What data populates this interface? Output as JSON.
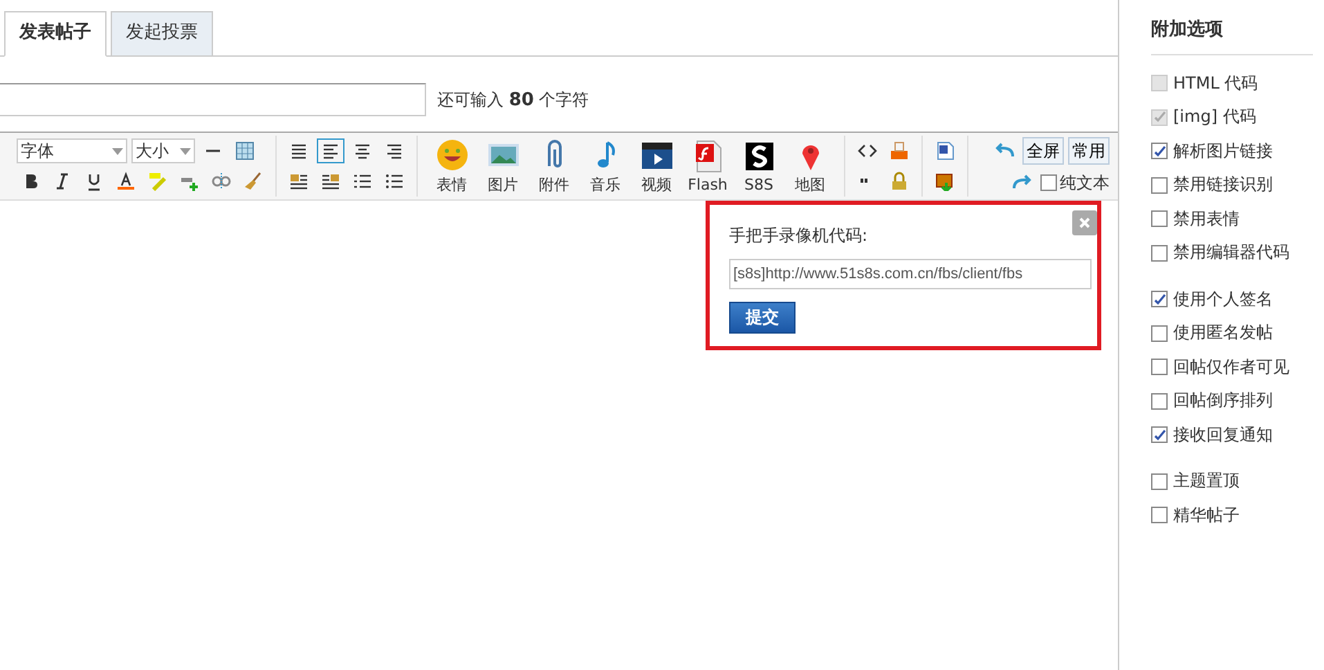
{
  "tabs": [
    {
      "label": "发表帖子",
      "selected": true
    },
    {
      "label": "发起投票",
      "selected": false
    }
  ],
  "subject": {
    "counter": "还可输入 **80** 个字符"
  },
  "toolbar": {
    "font_select": "字体",
    "size_select": "大小",
    "media_buttons": [
      {
        "kind": "smile",
        "label": "表情"
      },
      {
        "kind": "image",
        "label": "图片"
      },
      {
        "kind": "clip",
        "label": "附件"
      },
      {
        "kind": "note",
        "label": "音乐"
      },
      {
        "kind": "video",
        "label": "视频"
      },
      {
        "kind": "flash",
        "label": "Flash"
      },
      {
        "kind": "s8s",
        "label": "S8S"
      },
      {
        "kind": "pin",
        "label": "地图"
      }
    ],
    "fullscreen": "全屏",
    "common": "常用",
    "plain_text": {
      "label": "纯文本",
      "checked": false
    }
  },
  "dialog": {
    "title": "手把手录像机代码:",
    "value": "[s8s]http://www.51s8s.com.cn/fbs/client/fbs",
    "submit": "提交"
  },
  "sidebar": {
    "title": "附加选项",
    "groups": [
      [
        {
          "label": "HTML 代码",
          "checked": false,
          "disabled": true
        },
        {
          "label": "[img] 代码",
          "checked": true,
          "disabled": true
        },
        {
          "label": "解析图片链接",
          "checked": true,
          "disabled": false
        },
        {
          "label": "禁用链接识别",
          "checked": false,
          "disabled": false
        },
        {
          "label": "禁用表情",
          "checked": false,
          "disabled": false
        },
        {
          "label": "禁用编辑器代码",
          "checked": false,
          "disabled": false
        }
      ],
      [
        {
          "label": "使用个人签名",
          "checked": true,
          "disabled": false
        },
        {
          "label": "使用匿名发帖",
          "checked": false,
          "disabled": false
        },
        {
          "label": "回帖仅作者可见",
          "checked": false,
          "disabled": false
        },
        {
          "label": "回帖倒序排列",
          "checked": false,
          "disabled": false
        },
        {
          "label": "接收回复通知",
          "checked": true,
          "disabled": false
        }
      ],
      [
        {
          "label": "主题置顶",
          "checked": false,
          "disabled": false
        },
        {
          "label": "精华帖子",
          "checked": false,
          "disabled": false
        }
      ]
    ]
  }
}
